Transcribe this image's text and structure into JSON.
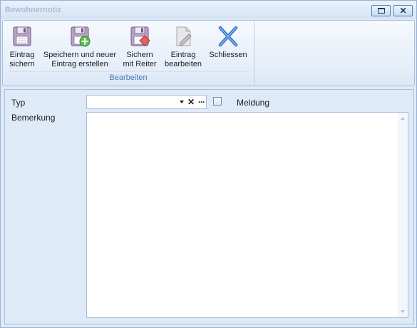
{
  "window": {
    "title": "Bewohnernotiz"
  },
  "ribbon": {
    "buttons": [
      {
        "label_line1": "Eintrag",
        "label_line2": "sichern",
        "icon": "floppy-disk-icon"
      },
      {
        "label_line1": "Speichern und neuer",
        "label_line2": "Eintrag erstellen",
        "icon": "floppy-disk-add-icon"
      },
      {
        "label_line1": "Sichern",
        "label_line2": "mit Reiter",
        "icon": "floppy-disk-tab-icon"
      },
      {
        "label_line1": "Eintrag",
        "label_line2": "bearbeiten",
        "icon": "edit-document-icon"
      },
      {
        "label_line1": "Schliessen",
        "label_line2": "",
        "icon": "close-x-icon"
      }
    ],
    "group_label": "Bearbeiten"
  },
  "form": {
    "typ_label": "Typ",
    "typ_value": "",
    "meldung_label": "Meldung",
    "meldung_checked": false,
    "bemerkung_label": "Bemerkung",
    "bemerkung_value": ""
  },
  "colors": {
    "title_text": "#a8bfdc",
    "group_label": "#4a7ab3",
    "window_bg": "#dfeaf8",
    "border": "#a5bedd"
  }
}
